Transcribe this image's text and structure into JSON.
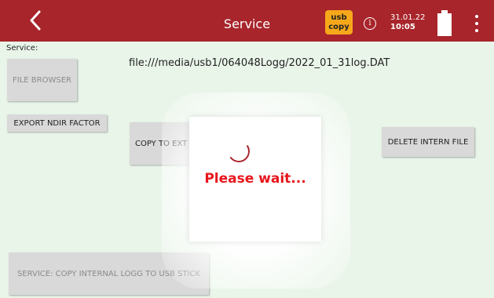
{
  "header": {
    "title": "Service",
    "usb_badge": {
      "line1": "usb",
      "line2": "copy"
    },
    "info_glyph": "i",
    "date": "31.01.22",
    "time": "10:05",
    "icons": [
      "chevron-left-icon",
      "info-icon",
      "battery-icon",
      "more-vert-icon"
    ],
    "colors": {
      "bar": "#a8252b",
      "badge": "#f7a81a"
    }
  },
  "main": {
    "service_label": "Service:",
    "file_path": "file:///media/usb1/064048Logg/2022_01_31log.DAT",
    "buttons": {
      "file_browser": "FILE BROWSER",
      "export_ndir": "EXPORT NDIR FACTOR",
      "copy_to_ext": "COPY TO EXT",
      "delete_intern": "DELETE INTERN FILE",
      "copy_internal": "SERVICE: COPY INTERNAL LOGG TO USB STICK"
    }
  },
  "dialog": {
    "message": "Please wait...",
    "message_color": "#e8151b"
  }
}
